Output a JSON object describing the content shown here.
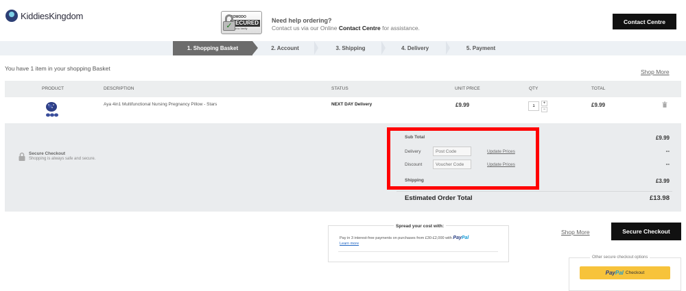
{
  "header": {
    "logo_text": "KiddiesKingdom",
    "badge": {
      "line1": "COMODO",
      "line2": "SECURED",
      "line3": "Point to Verify"
    },
    "help_title": "Need help ordering?",
    "help_pre": "Contact us via our Online ",
    "help_link": "Contact Centre",
    "help_post": " for assistance.",
    "contact_button": "Contact Centre"
  },
  "steps": [
    {
      "label": "1. Shopping Basket",
      "active": true
    },
    {
      "label": "2. Account",
      "active": false
    },
    {
      "label": "3. Shipping",
      "active": false
    },
    {
      "label": "4. Delivery",
      "active": false
    },
    {
      "label": "5. Payment",
      "active": false
    }
  ],
  "basket": {
    "intro": "You have 1 item in your shopping Basket",
    "shop_more": "Shop More",
    "columns": [
      "PRODUCT",
      "DESCRIPTION",
      "STATUS",
      "UNIT PRICE",
      "QTY",
      "TOTAL"
    ],
    "item": {
      "description": "Aya 4in1 Multifunctional Nursing Pregnancy Pillow - Stars",
      "status": "NEXT DAY Delivery",
      "unit_price": "£9.99",
      "qty": "1",
      "total": "£9.99"
    }
  },
  "summary": {
    "secure_title": "Secure Checkout",
    "secure_sub": "Shopping is always safe and secure.",
    "sub_total_label": "Sub Total",
    "sub_total_value": "£9.99",
    "delivery_label": "Delivery",
    "delivery_placeholder": "Post Code",
    "delivery_update": "Update Prices",
    "delivery_value": "--",
    "discount_label": "Discount",
    "discount_placeholder": "Voucher Code",
    "discount_update": "Update Prices",
    "discount_value": "--",
    "shipping_label": "Shipping",
    "shipping_value": "£3.99",
    "estimated_label": "Estimated Order Total",
    "estimated_value": "£13.98"
  },
  "spread": {
    "title": "Spread your cost with:",
    "text": "Pay in 3 interest-free payments on purchases from £30-£2,000 with",
    "paypal_a": "Pay",
    "paypal_b": "Pal",
    "learn_more": "Learn more"
  },
  "actions": {
    "shop_more": "Shop More",
    "secure_checkout": "Secure Checkout",
    "other_options": "Other secure checkout options",
    "paypal_a": "Pay",
    "paypal_b": "Pal",
    "paypal_checkout": "Checkout"
  },
  "colors": {
    "highlight": "#ff0000",
    "paypal_yellow": "#f7c33b",
    "paypal_blue": "#253b80",
    "paypal_light": "#179bd7"
  }
}
